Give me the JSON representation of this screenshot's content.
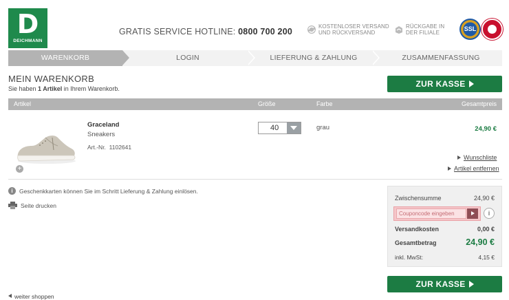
{
  "header": {
    "logo_letter": "D",
    "logo_name": "DEICHMANN",
    "hotline_label": "GRATIS SERVICE HOTLINE:",
    "hotline_number": "0800 700 200",
    "usp_shipping": [
      "KOSTENLOSER VERSAND",
      "UND RÜCKVERSAND"
    ],
    "usp_return": [
      "RÜCKGABE IN",
      "DER FILIALE"
    ],
    "ssl_badge": "SSL"
  },
  "steps": [
    {
      "label": "WARENKORB",
      "active": true
    },
    {
      "label": "LOGIN",
      "active": false
    },
    {
      "label": "LIEFERUNG & ZAHLUNG",
      "active": false
    },
    {
      "label": "ZUSAMMENFASSUNG",
      "active": false
    }
  ],
  "cart": {
    "title": "MEIN WARENKORB",
    "subtitle_prefix": "Sie haben ",
    "subtitle_count": "1 Artikel",
    "subtitle_suffix": " in Ihrem Warenkorb.",
    "checkout_label": "ZUR KASSE",
    "columns": {
      "article": "Artikel",
      "size": "Größe",
      "color": "Farbe",
      "total": "Gesamtpreis"
    }
  },
  "item": {
    "name": "Graceland",
    "type": "Sneakers",
    "article_no_label": "Art.-Nr.",
    "article_no": "1102641",
    "size": "40",
    "color": "grau",
    "price": "24,90 €",
    "wishlist_label": "Wunschliste",
    "remove_label": "Artikel entfernen",
    "zoom_label": "+"
  },
  "notes": {
    "giftcard": "Geschenkkarten können Sie im Schritt Lieferung & Zahlung einlösen.",
    "print": "Seite drucken"
  },
  "summary": {
    "subtotal_label": "Zwischensumme",
    "subtotal": "24,90 €",
    "coupon_placeholder": "Couponcode eingeben",
    "shipping_label": "Versandkosten",
    "shipping": "0,00 €",
    "total_label": "Gesamtbetrag",
    "total": "24,90 €",
    "vat_label": "inkl. MwSt:",
    "vat": "4,15 €"
  },
  "footer": {
    "back_label": "weiter shoppen"
  },
  "colors": {
    "brand_green": "#1c7c43",
    "step_active": "#b3b3b3",
    "coupon_highlight": "#f5c6c9"
  }
}
